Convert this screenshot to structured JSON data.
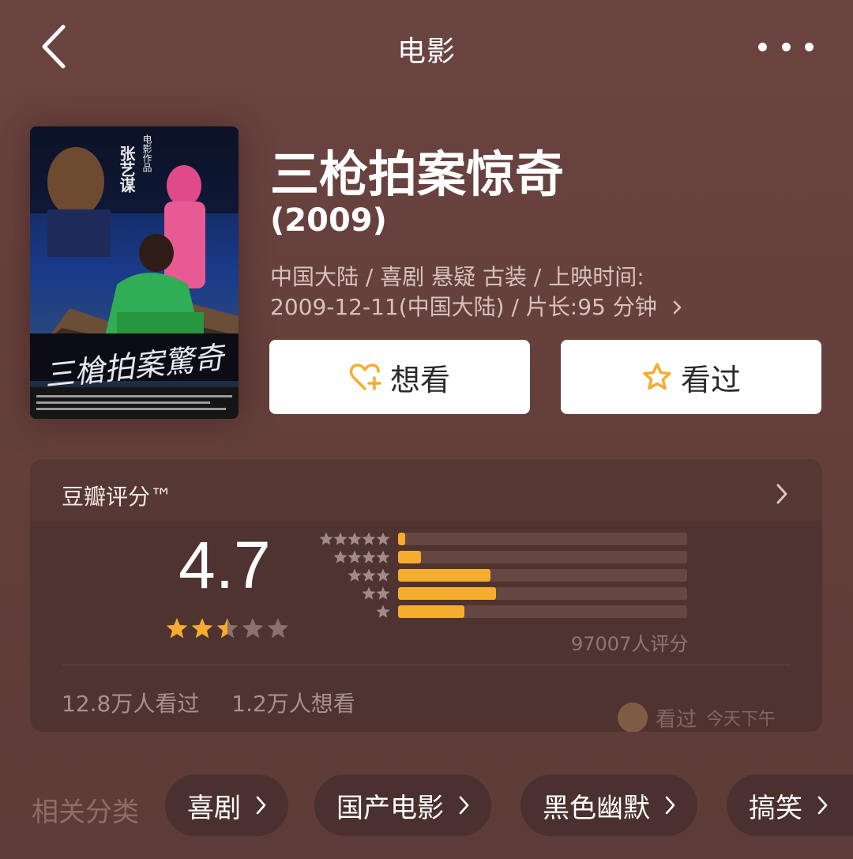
{
  "header": {
    "title": "电影"
  },
  "movie": {
    "title": "三枪拍案惊奇",
    "year": "(2009)",
    "meta_line1": "中国大陆 / 喜剧 悬疑 古装 / 上映时间:",
    "meta_line2": "2009-12-11(中国大陆) / 片长:95 分钟",
    "poster": {
      "director_text": "张艺谋",
      "studio_text": "电影作品"
    }
  },
  "actions": {
    "want_label": "想看",
    "seen_label": "看过"
  },
  "rating": {
    "label": "豆瓣评分™",
    "score": "4.7",
    "stars_value": 2.5,
    "distribution": [
      {
        "stars": 5,
        "percent": 2.5
      },
      {
        "stars": 4,
        "percent": 8
      },
      {
        "stars": 3,
        "percent": 32
      },
      {
        "stars": 2,
        "percent": 34
      },
      {
        "stars": 1,
        "percent": 23
      }
    ],
    "count_text": "97007人评分",
    "seen_count": "12.8万人看过",
    "want_count": "1.2万人想看",
    "friend_action": "看过",
    "friend_time": "今天下午"
  },
  "related": {
    "label": "相关分类",
    "tags": [
      "喜剧",
      "国产电影",
      "黑色幽默",
      "搞笑"
    ]
  },
  "colors": {
    "accent": "#f6ac2e",
    "background": "#643f3b",
    "card": "#4f3331"
  }
}
